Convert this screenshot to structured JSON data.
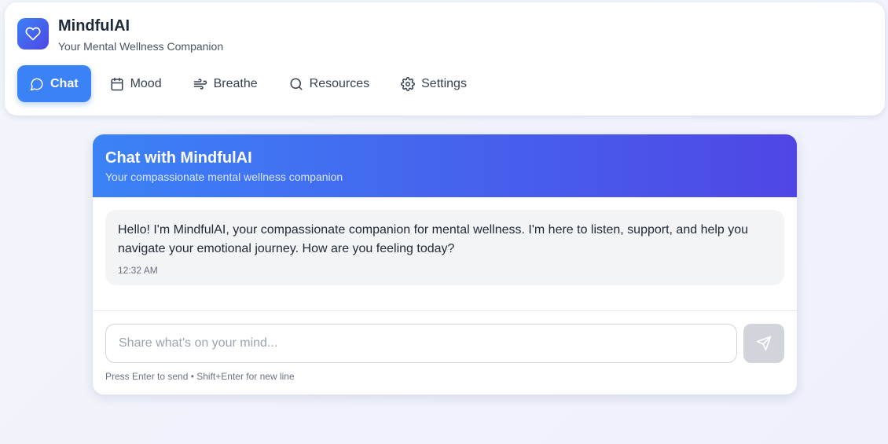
{
  "app": {
    "title": "MindfulAI",
    "subtitle": "Your Mental Wellness Companion",
    "logo_icon": "heart-icon",
    "accent": "#3b82f6",
    "accent_end": "#4f46e5"
  },
  "nav": {
    "items": [
      {
        "label": "Chat",
        "icon": "message-circle-icon",
        "active": true
      },
      {
        "label": "Mood",
        "icon": "calendar-icon",
        "active": false
      },
      {
        "label": "Breathe",
        "icon": "wind-icon",
        "active": false
      },
      {
        "label": "Resources",
        "icon": "search-icon",
        "active": false
      },
      {
        "label": "Settings",
        "icon": "gear-icon",
        "active": false
      }
    ]
  },
  "chat": {
    "title": "Chat with MindfulAI",
    "subtitle": "Your compassionate mental wellness companion",
    "messages": [
      {
        "sender": "assistant",
        "text": "Hello! I'm MindfulAI, your compassionate companion for mental wellness. I'm here to listen, support, and help you navigate your emotional journey. How are you feeling today?",
        "time": "12:32 AM"
      }
    ],
    "input": {
      "value": "",
      "placeholder": "Share what's on your mind..."
    },
    "send_icon": "send-icon",
    "hint": "Press Enter to send • Shift+Enter for new line"
  }
}
